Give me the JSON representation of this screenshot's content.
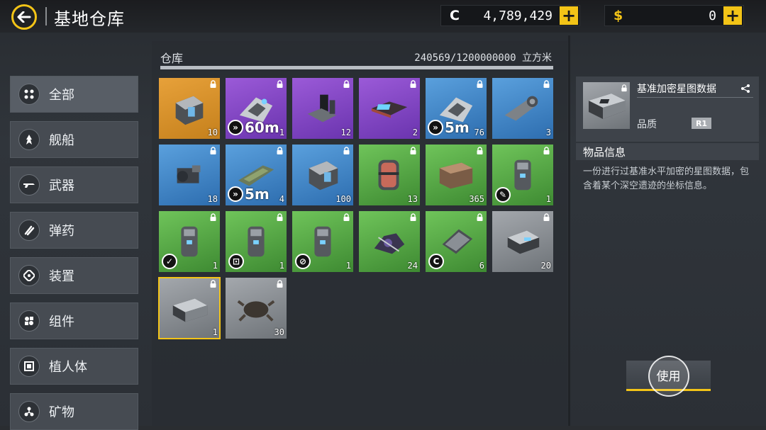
{
  "header": {
    "title": "基地仓库"
  },
  "currencies": [
    {
      "symbol": "C",
      "value": "4,789,429",
      "color": "#ffffff"
    },
    {
      "symbol": "$",
      "value": "0",
      "color": "#f3c417"
    }
  ],
  "sidebar": {
    "items": [
      {
        "label": "全部",
        "icon": "all-icon"
      },
      {
        "label": "舰船",
        "icon": "ship-icon"
      },
      {
        "label": "武器",
        "icon": "weapon-icon"
      },
      {
        "label": "弹药",
        "icon": "ammo-icon"
      },
      {
        "label": "装置",
        "icon": "device-icon"
      },
      {
        "label": "组件",
        "icon": "component-icon"
      },
      {
        "label": "植人体",
        "icon": "implant-icon"
      },
      {
        "label": "矿物",
        "icon": "mineral-icon"
      }
    ]
  },
  "storage": {
    "title": "仓库",
    "capacity": "240569/1200000000 立方米",
    "fill_fraction": 0.0002
  },
  "items": [
    {
      "count": "10",
      "rarity": "orange"
    },
    {
      "count": "1",
      "rarity": "purple",
      "range": "60m"
    },
    {
      "count": "12",
      "rarity": "purple"
    },
    {
      "count": "2",
      "rarity": "purple"
    },
    {
      "count": "76",
      "rarity": "blue",
      "range": "5m"
    },
    {
      "count": "3",
      "rarity": "blue"
    },
    {
      "count": "18",
      "rarity": "blue"
    },
    {
      "count": "4",
      "rarity": "blue",
      "range": "5m"
    },
    {
      "count": "100",
      "rarity": "blue"
    },
    {
      "count": "13",
      "rarity": "green"
    },
    {
      "count": "365",
      "rarity": "green"
    },
    {
      "count": "1",
      "rarity": "green",
      "badge": "✎"
    },
    {
      "count": "1",
      "rarity": "green",
      "badge": "✓"
    },
    {
      "count": "1",
      "rarity": "green",
      "badge": "⊡"
    },
    {
      "count": "1",
      "rarity": "green",
      "badge": "⊘"
    },
    {
      "count": "24",
      "rarity": "green"
    },
    {
      "count": "6",
      "rarity": "green",
      "badge": "C"
    },
    {
      "count": "20",
      "rarity": "gray"
    },
    {
      "count": "1",
      "rarity": "gray",
      "selected": true
    },
    {
      "count": "30",
      "rarity": "gray"
    }
  ],
  "detail": {
    "name": "基准加密星图数据",
    "quality_label": "品质",
    "quality_value": "R1"
  },
  "info": {
    "header": "物品信息",
    "description": "一份进行过基准水平加密的星图数据，包含着某个深空遗迹的坐标信息。"
  },
  "actions": {
    "use_label": "使用"
  },
  "colors": {
    "accent": "#f3c417"
  }
}
